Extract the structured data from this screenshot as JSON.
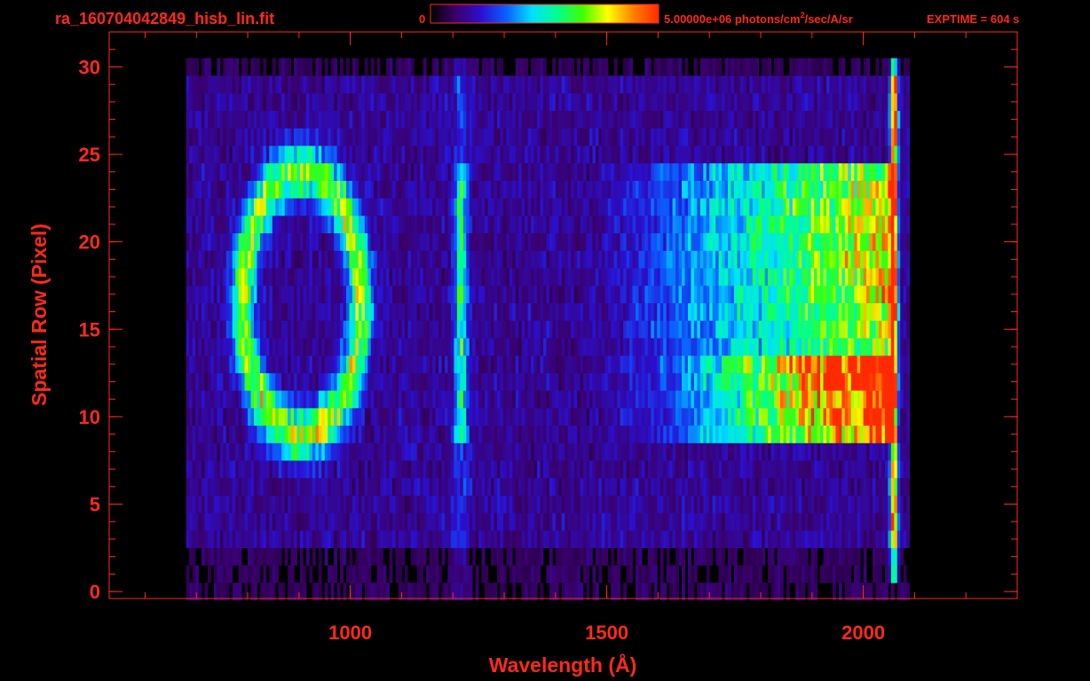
{
  "header": {
    "filename": "ra_160704042849_hisb_lin.fit",
    "colorbar_min": "0",
    "colorbar_max_value": "5.00000e+06 photons/cm",
    "colorbar_max_sup": "2",
    "colorbar_max_unit": "/sec/A/sr",
    "exptime": "EXPTIME = 604 s"
  },
  "colors": {
    "axis": "#ff2a1a",
    "background": "#000000",
    "colormap": [
      "#000000",
      "#3a006a",
      "#2a10d0",
      "#0a60ff",
      "#00e0ff",
      "#00ff90",
      "#40ff00",
      "#ffff00",
      "#ff8000",
      "#ff2a00"
    ]
  },
  "chart_data": {
    "type": "heatmap",
    "title": "ra_160704042849_hisb_lin.fit",
    "xlabel": "Wavelength (Å)",
    "ylabel": "Spatial Row (Pixel)",
    "xlim": [
      530,
      2300
    ],
    "ylim": [
      -0.4,
      32
    ],
    "x_ticks": [
      1000,
      1500,
      2000
    ],
    "x_tick_labels": [
      "1000",
      "1500",
      "2000"
    ],
    "x_minor_step": 100,
    "y_ticks": [
      0,
      5,
      10,
      15,
      20,
      25,
      30
    ],
    "y_tick_labels": [
      "0",
      "5",
      "10",
      "15",
      "20",
      "25",
      "30"
    ],
    "y_minor_step": 1,
    "rows": [
      0,
      30
    ],
    "wavelength_coverage": [
      680,
      2090
    ],
    "color_scale": {
      "min": 0,
      "max": 5000000,
      "unit": "photons/cm2/sec/A/sr"
    },
    "features": [
      {
        "kind": "continuum",
        "wavelength_range": [
          1680,
          2060
        ],
        "row_range": [
          9,
          24
        ],
        "intensity": 0.72
      },
      {
        "kind": "band",
        "wavelength_range": [
          1600,
          2060
        ],
        "row_range": [
          9,
          13
        ],
        "intensity": 0.6
      },
      {
        "kind": "line",
        "wavelength": 1216,
        "row_range": [
          9,
          24
        ],
        "intensity": 0.45
      },
      {
        "kind": "ring",
        "wavelength_range": [
          790,
          1020
        ],
        "row_range": [
          9,
          24
        ],
        "intensity": 0.6
      },
      {
        "kind": "edge",
        "wavelength": 2060,
        "row_range": [
          1,
          30
        ],
        "intensity": 0.9
      }
    ],
    "grid": false
  }
}
